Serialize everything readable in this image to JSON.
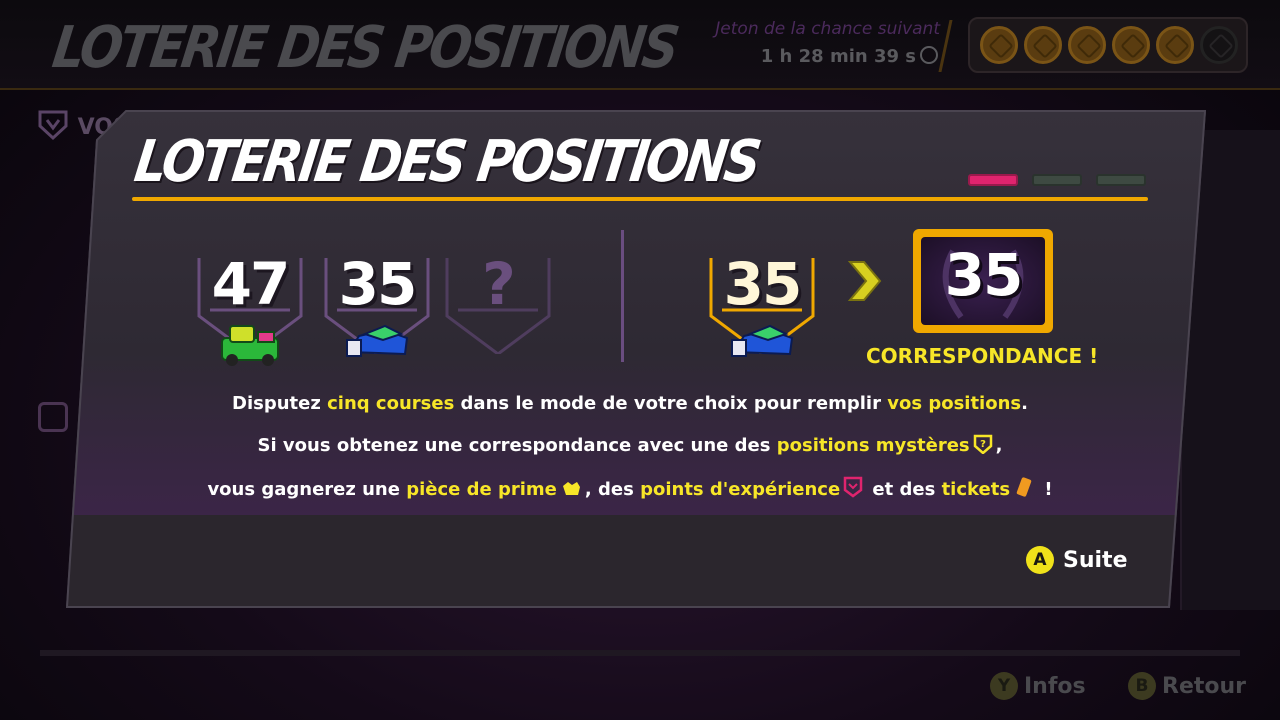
{
  "background": {
    "title": "LOTERIE DES POSITIONS",
    "next_token_label": "Jeton de la chance suivant",
    "timer": "1 h 28 min 39 s",
    "tokens_filled": 5,
    "tokens_total": 6,
    "side_label": "VOS",
    "buttons": {
      "info_key": "Y",
      "info_label": "Infos",
      "back_key": "B",
      "back_label": "Retour"
    }
  },
  "modal": {
    "title": "LOTERIE DES POSITIONS",
    "page_indicator": {
      "current": 1,
      "total": 3
    },
    "slots": [
      {
        "value": "47"
      },
      {
        "value": "35"
      },
      {
        "value": "?"
      }
    ],
    "result_slot": {
      "value": "35"
    },
    "match_value": "35",
    "match_label": "CORRESPONDANCE !",
    "desc1": {
      "p1": "Disputez ",
      "h1": "cinq courses",
      "p2": " dans le mode de votre choix pour remplir ",
      "h2": "vos positions",
      "p3": "."
    },
    "desc2": {
      "p1": "Si vous obtenez une correspondance avec une des ",
      "h1": "positions mystères",
      "p2": ","
    },
    "desc3": {
      "p1": "vous gagnerez une ",
      "h1": "pièce de prime",
      "p2": ", des ",
      "h2": "points d'expérience",
      "p3": " et des ",
      "h3": "tickets",
      "p4": " !"
    },
    "continue_key": "A",
    "continue_label": "Suite"
  },
  "colors": {
    "accent_gold": "#f0a800",
    "highlight_yellow": "#f7e628",
    "page_active": "#e0246e",
    "slot_purple": "#6a4f7e"
  }
}
